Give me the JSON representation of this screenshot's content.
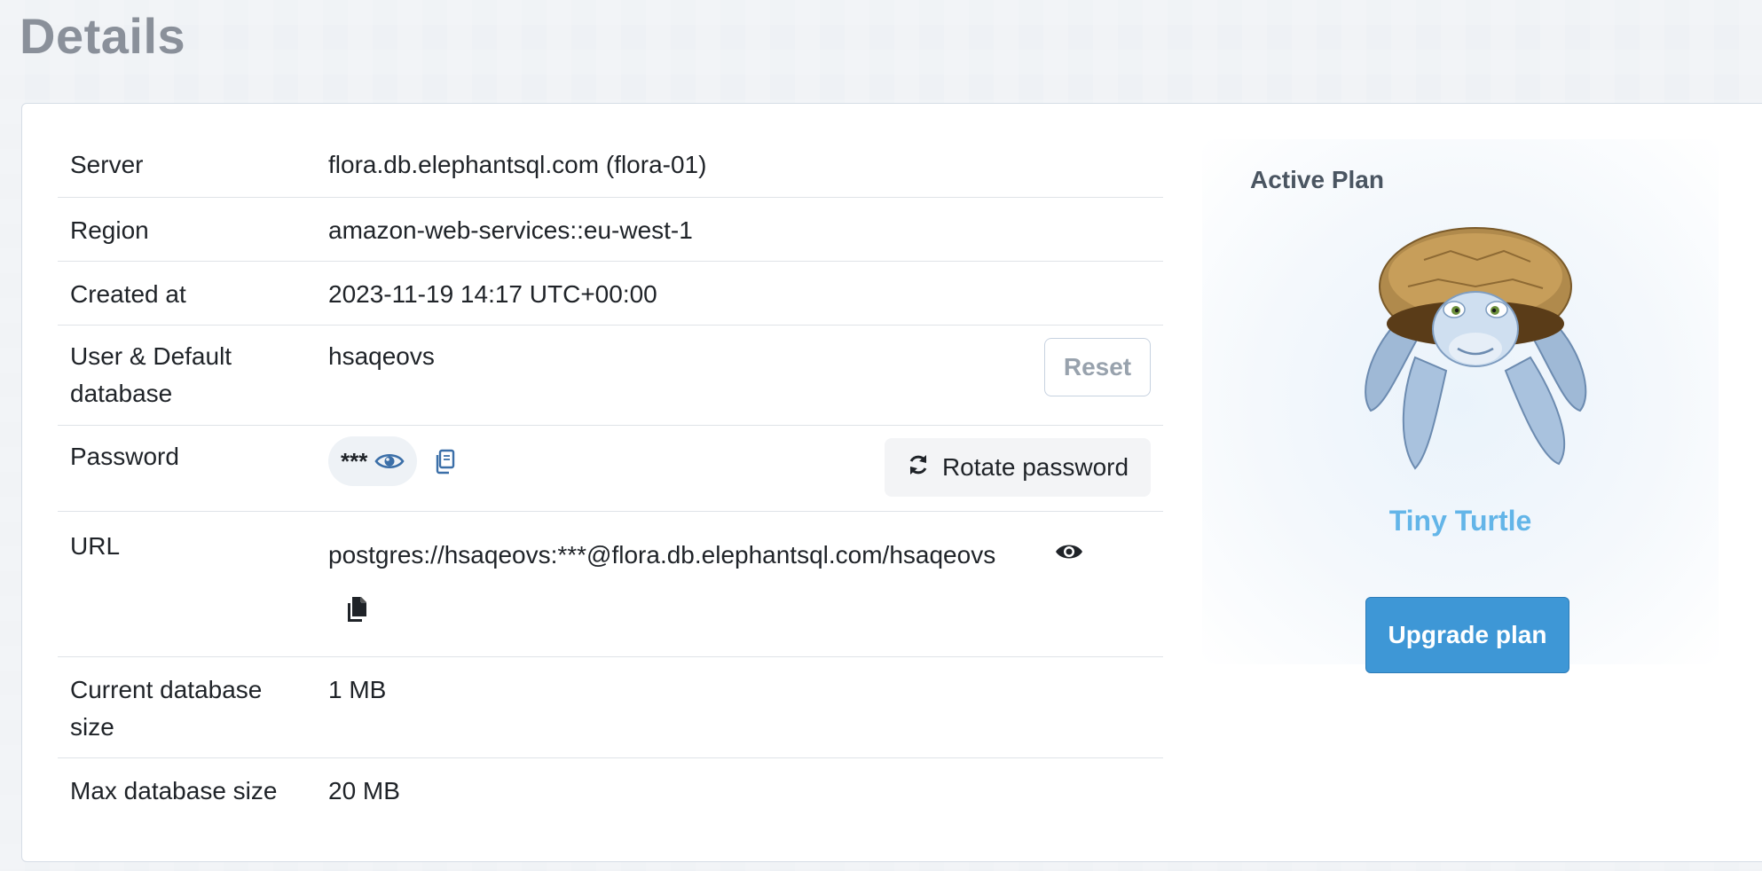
{
  "page": {
    "title": "Details"
  },
  "details": {
    "server": {
      "label": "Server",
      "value": "flora.db.elephantsql.com (flora-01)"
    },
    "region": {
      "label": "Region",
      "value": "amazon-web-services::eu-west-1"
    },
    "created_at": {
      "label": "Created at",
      "value": "2023-11-19 14:17 UTC+00:00"
    },
    "user": {
      "label_line1": "User & Default",
      "label_line2": "database",
      "value": "hsaqeovs",
      "reset_label": "Reset"
    },
    "password": {
      "label": "Password",
      "masked": "***",
      "rotate_label": "Rotate password"
    },
    "url": {
      "label": "URL",
      "value": "postgres://hsaqeovs:***@flora.db.elephantsql.com/hsaqeovs"
    },
    "current_size": {
      "label_line1": "Current database",
      "label_line2": "size",
      "value": "1 MB"
    },
    "max_size": {
      "label": "Max database size",
      "value": "20 MB"
    }
  },
  "plan": {
    "heading": "Active Plan",
    "name": "Tiny Turtle",
    "upgrade_label": "Upgrade plan"
  },
  "icons": {
    "show_password": "eye-icon",
    "copy_password": "copy-icon",
    "rotate": "refresh-icon",
    "show_url": "eye-icon",
    "copy_url": "file-copy-icon",
    "mascot": "turtle-illustration"
  },
  "colors": {
    "accent": "#3e97d6",
    "plan_name": "#63b5e8",
    "icon_blue": "#3b6fa8"
  }
}
